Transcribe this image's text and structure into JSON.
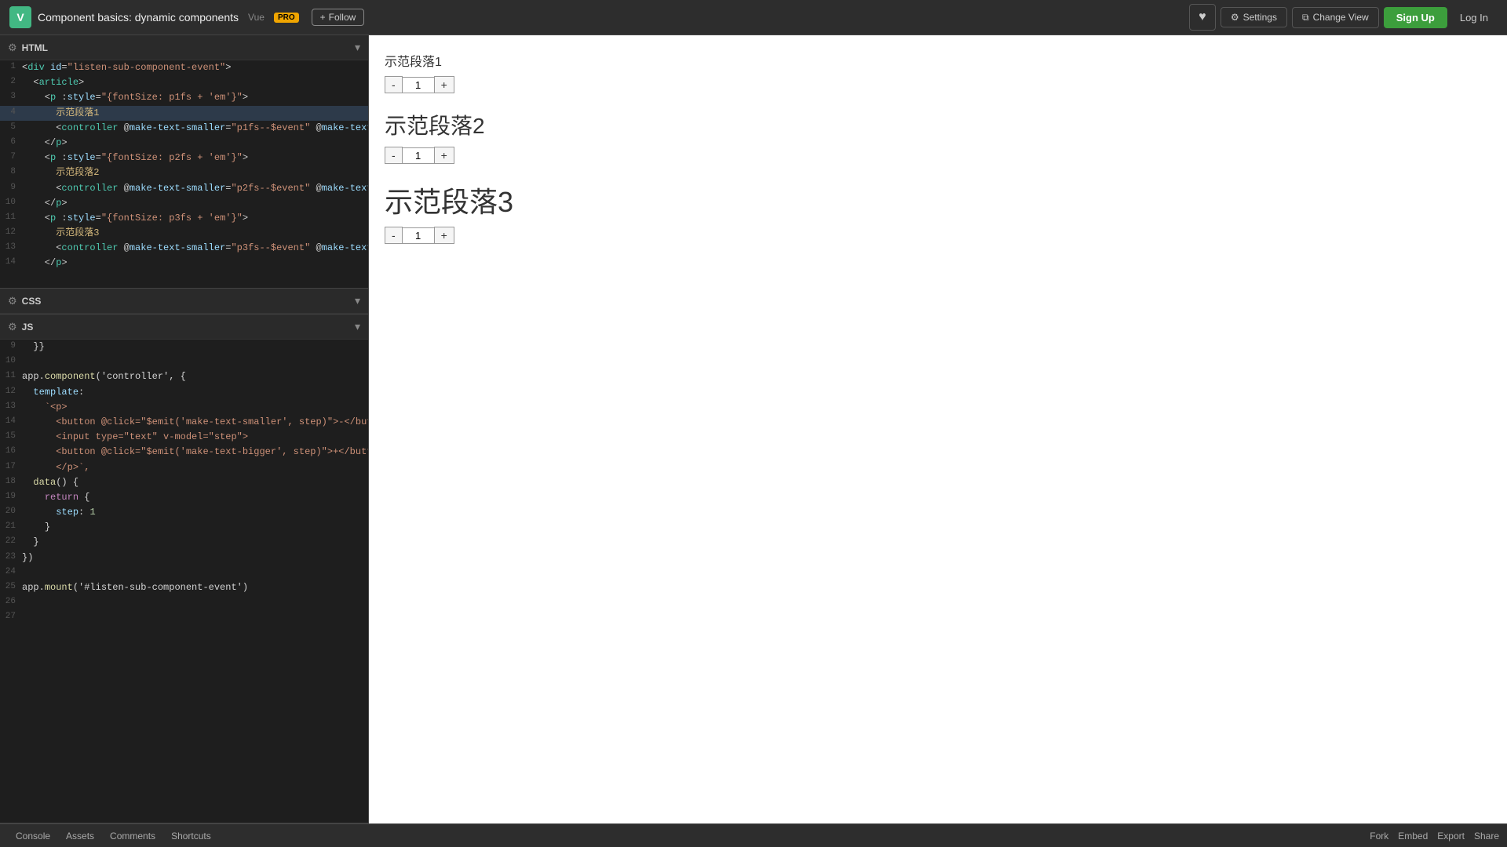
{
  "app": {
    "title": "Component basics: dynamic components",
    "framework": "Vue",
    "pro_badge": "PRO",
    "follow_label": "Follow",
    "heart_icon": "♥",
    "settings_label": "Settings",
    "changeview_label": "Change View",
    "signup_label": "Sign Up",
    "login_label": "Log In"
  },
  "panels": {
    "html_label": "HTML",
    "css_label": "CSS",
    "js_label": "JS"
  },
  "preview": {
    "section1_text": "示范段落1",
    "section2_text": "示范段落2",
    "section3_text": "示范段落3",
    "counter1_value": "1",
    "counter2_value": "1",
    "counter3_value": "1"
  },
  "bottom": {
    "console_label": "Console",
    "assets_label": "Assets",
    "comments_label": "Comments",
    "shortcuts_label": "Shortcuts",
    "fork_label": "Fork",
    "embed_label": "Embed",
    "export_label": "Export",
    "share_label": "Share"
  }
}
